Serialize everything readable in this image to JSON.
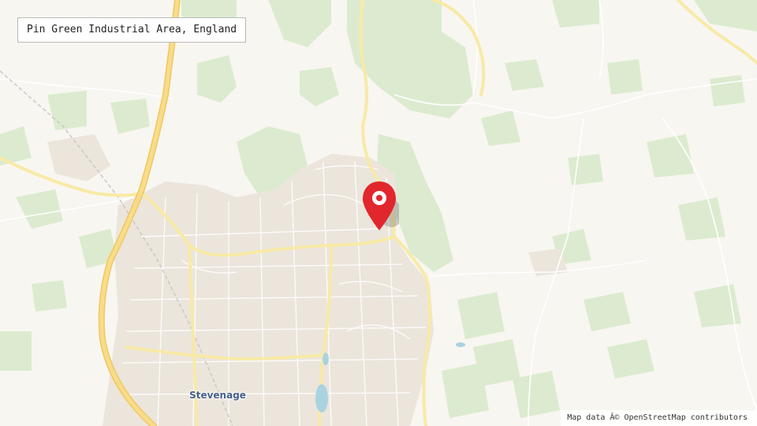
{
  "map": {
    "title": "Pin Green Industrial Area, England",
    "town_label": "Stevenage",
    "attribution": "Map data Â© OpenStreetMap contributors",
    "marker_icon": "location-pin-icon",
    "colors": {
      "background": "#f8f6f1",
      "woodland": "#dcebcf",
      "urban": "#ebe5dc",
      "motorway": "#f5d98a",
      "major_road": "#f8eaa6",
      "pin": "#e1262d",
      "water": "#aad3df",
      "town_label": "#47608a"
    }
  }
}
